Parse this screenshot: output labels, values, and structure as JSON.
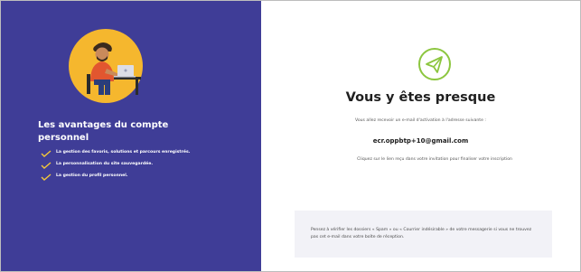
{
  "colors": {
    "left_panel_bg": "#3f3d97",
    "accent_green": "#8cc63f",
    "check_yellow": "#f3c73a",
    "illustration_circle": "#f5b72e",
    "notice_bg": "#f2f2f7"
  },
  "left_panel": {
    "illustration_icon": "person-at-laptop-illustration",
    "title": "Les avantages du compte personnel",
    "benefits": [
      {
        "icon": "check-icon",
        "text": "La gestion des favoris, solutions et parcours enregistrés."
      },
      {
        "icon": "check-icon",
        "text": "La personnalisation du site sauvegardée."
      },
      {
        "icon": "check-icon",
        "text": "La gestion du profil personnel."
      }
    ]
  },
  "right_panel": {
    "icon": "paper-plane-icon",
    "heading": "Vous y êtes presque",
    "intro": "Vous allez recevoir un e-mail d'activation à l'adresse suivante :",
    "email": "ecr.oppbtp+10@gmail.com",
    "instruction": "Cliquez sur le lien reçu dans votre invitation pour finaliser votre inscription",
    "notice": "Pensez à vérifier les dossiers « Spam » ou « Courrier indésirable » de votre messagerie si vous ne trouvez pas cet e-mail dans votre boîte de réception."
  }
}
